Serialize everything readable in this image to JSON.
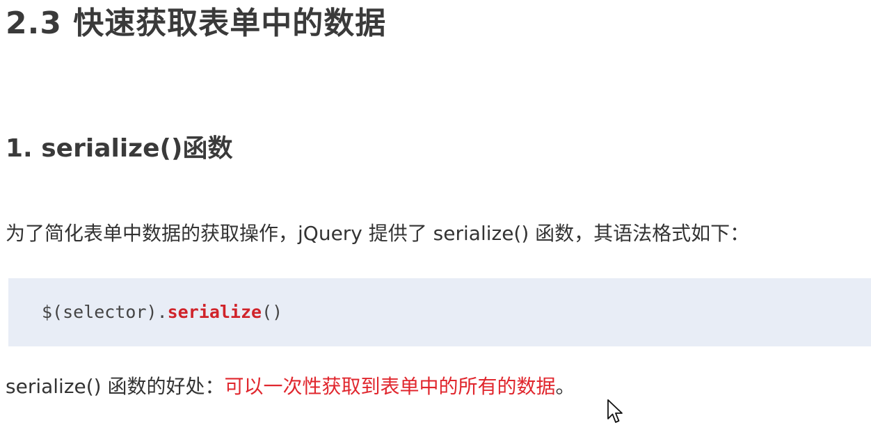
{
  "heading": {
    "title": "2.3 快速获取表单中的数据"
  },
  "section": {
    "subtitle": "1. serialize()函数"
  },
  "intro": {
    "text": "为了简化表单中数据的获取操作，jQuery 提供了 serialize() 函数，其语法格式如下："
  },
  "code": {
    "prefix": "$(selector).",
    "function": "serialize",
    "suffix": "()"
  },
  "benefit": {
    "label": "serialize() 函数的好处：",
    "highlight": "可以一次性获取到表单中的所有的数据",
    "end": "。"
  },
  "colors": {
    "code_background": "#e8edf6",
    "highlight_red": "#e0262d",
    "code_function_red": "#d0232a"
  },
  "icons": {
    "cursor": "mouse-pointer-icon"
  }
}
